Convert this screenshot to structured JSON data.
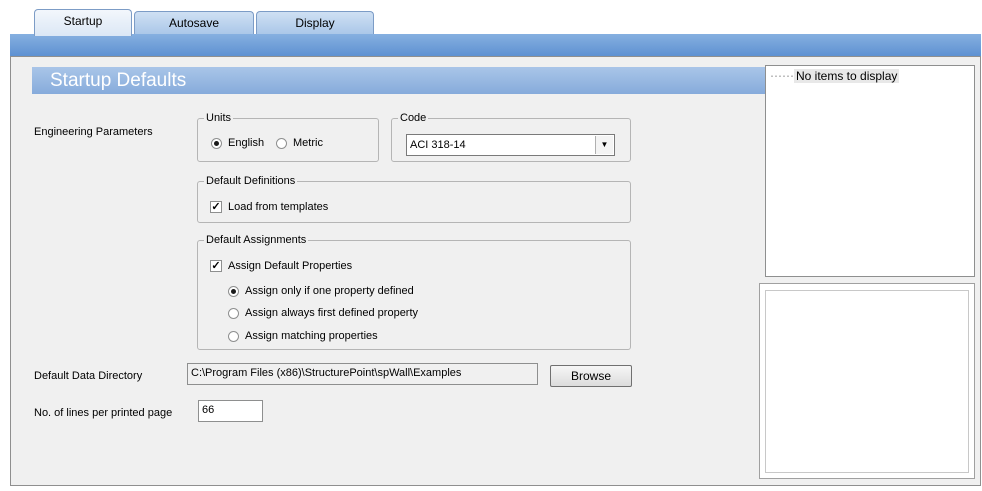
{
  "tabs": [
    {
      "label": "Startup",
      "active": true
    },
    {
      "label": "Autosave",
      "active": false
    },
    {
      "label": "Display",
      "active": false
    }
  ],
  "section_title": "Startup Defaults",
  "engineering_parameters_label": "Engineering Parameters",
  "units": {
    "legend": "Units",
    "options": [
      {
        "label": "English",
        "selected": true
      },
      {
        "label": "Metric",
        "selected": false
      }
    ]
  },
  "code": {
    "legend": "Code",
    "value": "ACI 318-14"
  },
  "default_definitions": {
    "legend": "Default Definitions",
    "load_from_templates": {
      "label": "Load from templates",
      "checked": true
    }
  },
  "default_assignments": {
    "legend": "Default Assignments",
    "assign_default_properties": {
      "label": "Assign Default Properties",
      "checked": true
    },
    "options": [
      {
        "label": "Assign only if one property defined",
        "selected": true
      },
      {
        "label": "Assign always first defined property",
        "selected": false
      },
      {
        "label": "Assign matching properties",
        "selected": false
      }
    ]
  },
  "data_directory": {
    "label": "Default Data Directory",
    "value": "C:\\Program Files (x86)\\StructurePoint\\spWall\\Examples",
    "browse_label": "Browse"
  },
  "lines_per_page": {
    "label": "No. of lines per printed page",
    "value": "66"
  },
  "right_list": {
    "empty_text": "No items to display"
  },
  "colors": {
    "header_blue": "#86abdb",
    "tab_strip_blue": "#5e91d2",
    "panel_bg": "#f0f0f0"
  }
}
